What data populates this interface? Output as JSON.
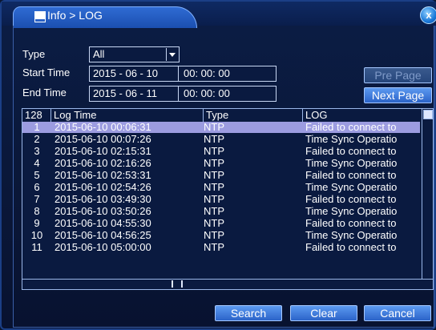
{
  "window": {
    "title": "Info > LOG",
    "close_glyph": "x"
  },
  "filters": {
    "type_label": "Type",
    "type_value": "All",
    "start_label": "Start Time",
    "start_date": "2015 - 06 - 10",
    "start_time": "00: 00: 00",
    "end_label": "End Time",
    "end_date": "2015 - 06 - 11",
    "end_time": "00: 00: 00"
  },
  "paging": {
    "pre_label": "Pre Page",
    "next_label": "Next Page"
  },
  "table": {
    "count": "128",
    "headers": {
      "time": "Log Time",
      "type": "Type",
      "log": "LOG"
    },
    "rows": [
      {
        "n": "1",
        "time": "2015-06-10 00:06:31",
        "type": "NTP",
        "log": "Failed to connect to"
      },
      {
        "n": "2",
        "time": "2015-06-10 00:07:26",
        "type": "NTP",
        "log": "Time Sync Operatio"
      },
      {
        "n": "3",
        "time": "2015-06-10 02:15:31",
        "type": "NTP",
        "log": "Failed to connect to"
      },
      {
        "n": "4",
        "time": "2015-06-10 02:16:26",
        "type": "NTP",
        "log": "Time Sync Operatio"
      },
      {
        "n": "5",
        "time": "2015-06-10 02:53:31",
        "type": "NTP",
        "log": "Failed to connect to"
      },
      {
        "n": "6",
        "time": "2015-06-10 02:54:26",
        "type": "NTP",
        "log": "Time Sync Operatio"
      },
      {
        "n": "7",
        "time": "2015-06-10 03:49:30",
        "type": "NTP",
        "log": "Failed to connect to"
      },
      {
        "n": "8",
        "time": "2015-06-10 03:50:26",
        "type": "NTP",
        "log": "Time Sync Operatio"
      },
      {
        "n": "9",
        "time": "2015-06-10 04:55:30",
        "type": "NTP",
        "log": "Failed to connect to"
      },
      {
        "n": "10",
        "time": "2015-06-10 04:56:25",
        "type": "NTP",
        "log": "Time Sync Operatio"
      },
      {
        "n": "11",
        "time": "2015-06-10 05:00:00",
        "type": "NTP",
        "log": "Failed to connect to"
      }
    ]
  },
  "actions": {
    "search": "Search",
    "clear": "Clear",
    "cancel": "Cancel"
  },
  "colors": {
    "selected_row": "#9c9ce0",
    "button": "#3f7fe0"
  }
}
